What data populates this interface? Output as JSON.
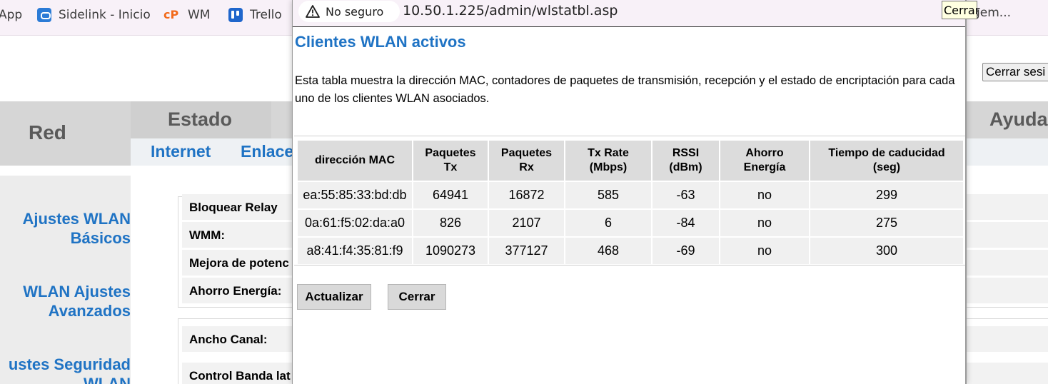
{
  "browser": {
    "bookmarks": [
      {
        "label": "App"
      },
      {
        "label": "Sidelink - Inicio",
        "icon": "sidelink-icon"
      },
      {
        "label": "WM",
        "icon": "wm-icon"
      },
      {
        "label": "Trello",
        "icon": "trello-icon"
      }
    ],
    "bookmark_tail": "gem...",
    "tooltip": "Cerrar"
  },
  "background": {
    "logout_button": "Cerrar sesi",
    "nav": {
      "red": "Red",
      "estado": "Estado",
      "ayuda": "Ayuda"
    },
    "subnav": {
      "internet": "Internet",
      "enlace": "Enlace"
    },
    "sidebar": [
      {
        "line1": "Ajustes WLAN",
        "line2": "Básicos"
      },
      {
        "line1": "WLAN Ajustes",
        "line2": "Avanzados"
      },
      {
        "line1": "ustes Seguridad",
        "line2": "WLAN"
      }
    ],
    "form_labels": [
      "Bloquear Relay",
      "WMM:",
      "Mejora de potenc",
      "Ahorro Energía:",
      "Ancho Canal:",
      "Control Banda lat"
    ]
  },
  "popup": {
    "security_label": "No seguro",
    "url": "10.50.1.225/admin/wlstatbl.asp",
    "title": "Clientes WLAN activos",
    "description": "Esta tabla muestra la dirección MAC, contadores de paquetes de transmisión, recepción y el estado de encriptación para cada uno de los clientes WLAN asociados.",
    "table": {
      "headers": [
        {
          "l1": "dirección MAC",
          "l2": ""
        },
        {
          "l1": "Paquetes",
          "l2": "Tx"
        },
        {
          "l1": "Paquetes",
          "l2": "Rx"
        },
        {
          "l1": "Tx Rate",
          "l2": "(Mbps)"
        },
        {
          "l1": "RSSI",
          "l2": "(dBm)"
        },
        {
          "l1": "Ahorro",
          "l2": "Energía"
        },
        {
          "l1": "Tiempo de caducidad",
          "l2": "(seg)"
        }
      ],
      "rows": [
        [
          "ea:55:85:33:bd:db",
          "64941",
          "16872",
          "585",
          "-63",
          "no",
          "299"
        ],
        [
          "0a:61:f5:02:da:a0",
          "826",
          "2107",
          "6",
          "-84",
          "no",
          "275"
        ],
        [
          "a8:41:f4:35:81:f9",
          "1090273",
          "377127",
          "468",
          "-69",
          "no",
          "300"
        ]
      ]
    },
    "buttons": {
      "refresh": "Actualizar",
      "close": "Cerrar"
    }
  },
  "colors": {
    "link_blue": "#1f73c4",
    "header_gray": "#dcdcdc",
    "row_gray": "#f0f0f0"
  }
}
